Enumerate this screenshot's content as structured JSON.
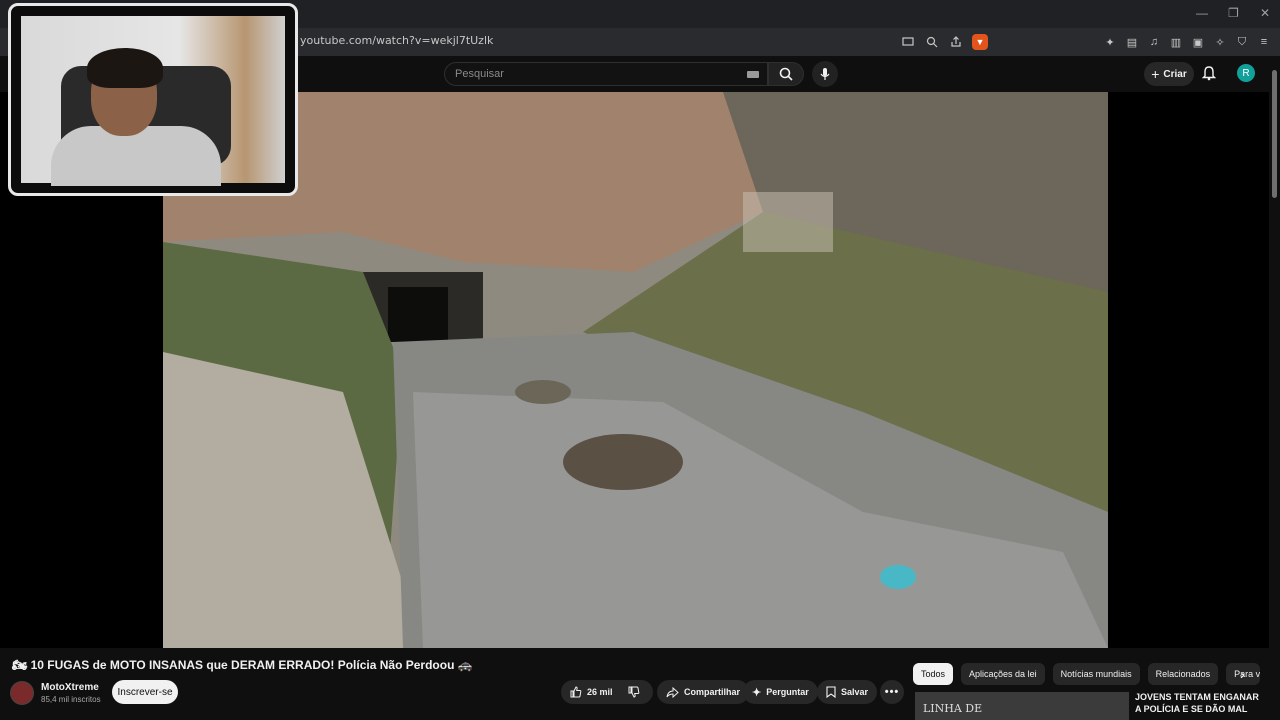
{
  "browser": {
    "url": "youtube.com/watch?v=wekjl7tUzlk",
    "window_controls": [
      "—",
      "❐",
      "✕"
    ]
  },
  "header": {
    "search_placeholder": "Pesquisar",
    "create_label": "Criar",
    "avatar_letter": "R"
  },
  "video": {
    "title": "10 FUGAS de MOTO INSANAS que DERAM ERRADO! Polícia Não Perdoou",
    "title_emoji_left": "🏍",
    "title_emoji_right": "🚓",
    "channel_name": "MotoXtreme",
    "channel_subs": "85,4 mil inscritos",
    "subscribe_label": "Inscrever-se",
    "like_count": "26 mil",
    "share_label": "Compartilhar",
    "ask_label": "Perguntar",
    "save_label": "Salvar"
  },
  "chips": [
    "Todos",
    "Aplicações da lei",
    "Notícias mundiais",
    "Relacionados",
    "Para v"
  ],
  "recommendation": {
    "thumb_text": "LINHA DE",
    "title": "JOVENS TENTAM ENGANAR A POLÍCIA E SE DÃO MAL"
  },
  "colors": {
    "background": "#0f0f0f",
    "accent_avatar": "#12a09a",
    "brave": "#e2541b"
  }
}
